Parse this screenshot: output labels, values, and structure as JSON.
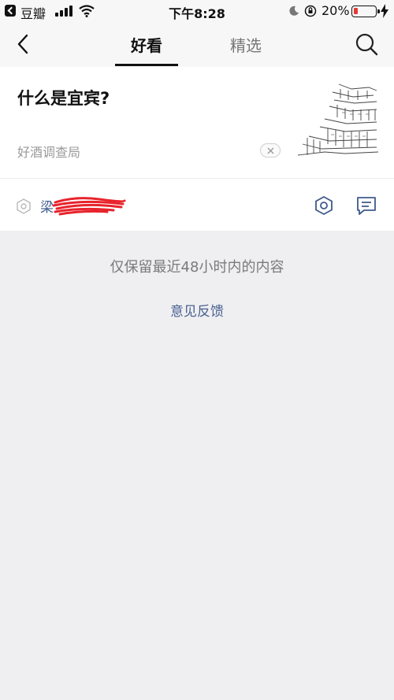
{
  "status_bar": {
    "back_app": "豆瓣",
    "time": "下午8:28",
    "battery_percent": "20%",
    "battery_level": 0.2,
    "battery_color": "#e53935"
  },
  "nav": {
    "tabs": [
      {
        "label": "好看",
        "active": true
      },
      {
        "label": "精选",
        "active": false
      }
    ],
    "back_icon": "chevron-left-icon",
    "search_icon": "search-icon"
  },
  "article": {
    "title": "什么是宜宾?",
    "source": "好酒调查局",
    "author_name": "梁",
    "thumbnail": "pagoda-sketch-image"
  },
  "notice": {
    "text": "仅保留最近48小时内的内容",
    "feedback_label": "意见反馈"
  },
  "colors": {
    "accent_link": "#4a6291",
    "redaction": "#e8232c"
  }
}
